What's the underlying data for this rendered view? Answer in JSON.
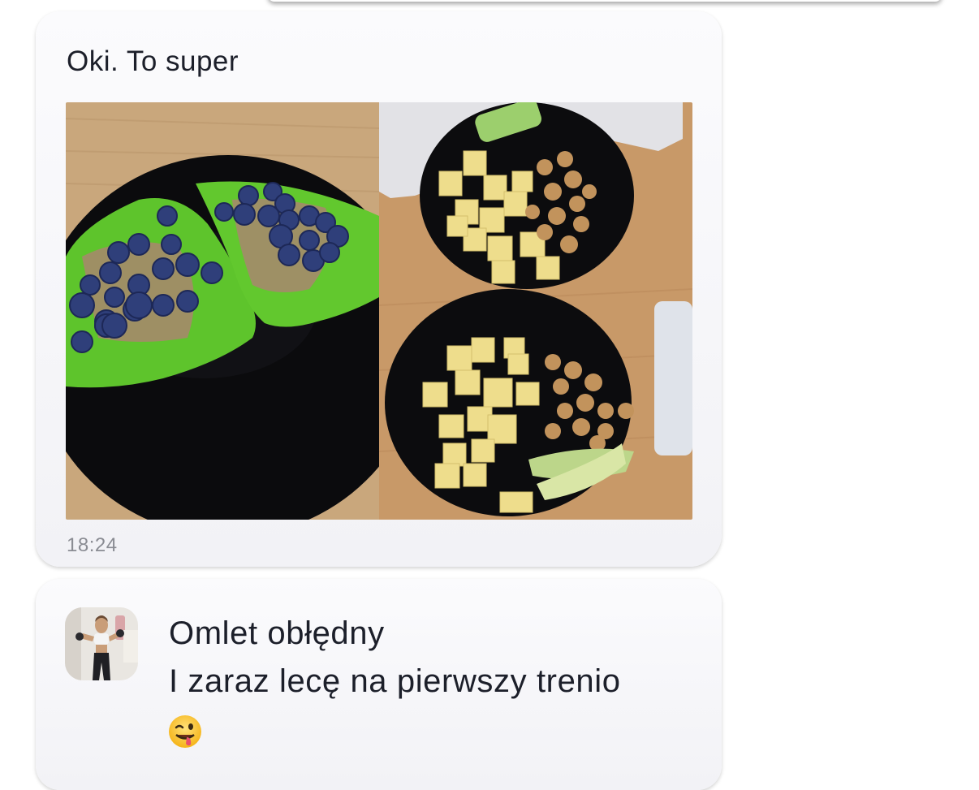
{
  "messages": [
    {
      "text": "Oki. To super",
      "time": "18:24",
      "attachment": {
        "kind": "photo"
      }
    },
    {
      "lines": [
        "Omlet obłędny",
        "I zaraz lecę na pierwszy trenio"
      ],
      "emoji": "winking-face-with-tongue-icon"
    }
  ]
}
